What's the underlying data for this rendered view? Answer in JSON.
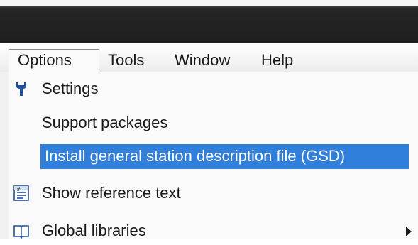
{
  "menubar": {
    "items": [
      {
        "label": "Options",
        "open": true
      },
      {
        "label": "Tools"
      },
      {
        "label": "Window"
      },
      {
        "label": "Help"
      }
    ]
  },
  "options_menu": {
    "items": [
      {
        "label": "Settings",
        "icon": "wrench-icon"
      },
      {
        "label": "Support packages"
      },
      {
        "label": "Install general station description file (GSD)",
        "highlighted": true
      },
      {
        "label": "Show reference text",
        "icon": "reference-text-icon"
      },
      {
        "label": "Global libraries",
        "icon": "book-icon",
        "has_submenu": true
      }
    ]
  },
  "colors": {
    "highlight": "#2f7fdb",
    "title_bar": "#1e1e1e"
  }
}
